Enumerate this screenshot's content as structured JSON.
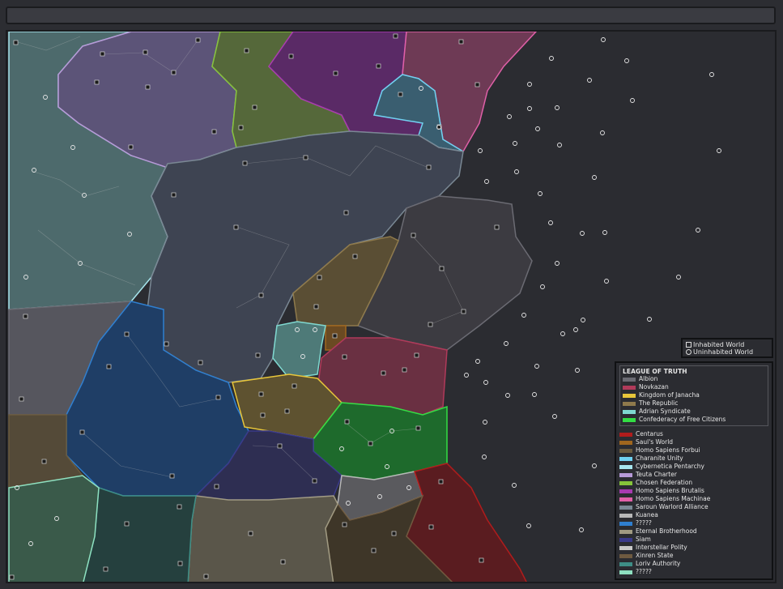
{
  "legend_key": {
    "inhabited": "Inhabited World",
    "uninhabited": "Uninhabited World"
  },
  "league": {
    "title": "LEAGUE OF TRUTH",
    "members": [
      {
        "name": "Albion",
        "color": "#6b6b73"
      },
      {
        "name": "Novkazan",
        "color": "#b03a5a"
      },
      {
        "name": "Kingdom of Janacha",
        "color": "#e8c63a"
      },
      {
        "name": "The Republic",
        "color": "#8f7a4c"
      },
      {
        "name": "Adrian Syndicate",
        "color": "#7fd8d0"
      },
      {
        "name": "Confederacy of Free Citizens",
        "color": "#33dd44"
      }
    ]
  },
  "others": [
    {
      "name": "Centarus",
      "color": "#b01c1c"
    },
    {
      "name": "Saul's World",
      "color": "#a0661e"
    },
    {
      "name": "Homo Sapiens Forbui",
      "color": "#6a5b3e"
    },
    {
      "name": "Charanite Unity",
      "color": "#6fd1f0"
    },
    {
      "name": "Cybernetica Pentarchy",
      "color": "#a8e6ee"
    },
    {
      "name": "Teuta Charter",
      "color": "#b79ad8"
    },
    {
      "name": "Chosen Federation",
      "color": "#86c43a"
    },
    {
      "name": "Homo Sapiens Brutalis",
      "color": "#a83ab0"
    },
    {
      "name": "Homo Sapiens Machinae",
      "color": "#e060a8"
    },
    {
      "name": "Saroun Warlord Alliance",
      "color": "#7a8894"
    },
    {
      "name": "Kuanea",
      "color": "#b8b8b8"
    },
    {
      "name": "?????",
      "color": "#2f7fd0"
    },
    {
      "name": "Eternal Brotherhood",
      "color": "#a09a82"
    },
    {
      "name": "Siam",
      "color": "#3a3a8a"
    },
    {
      "name": "Interstellar Polity",
      "color": "#c8c8c8"
    },
    {
      "name": "Xinren State",
      "color": "#6e5a40"
    },
    {
      "name": "Loriv Authority",
      "color": "#3e8e86"
    },
    {
      "name": "?????",
      "color": "#8ee0c0"
    }
  ]
}
